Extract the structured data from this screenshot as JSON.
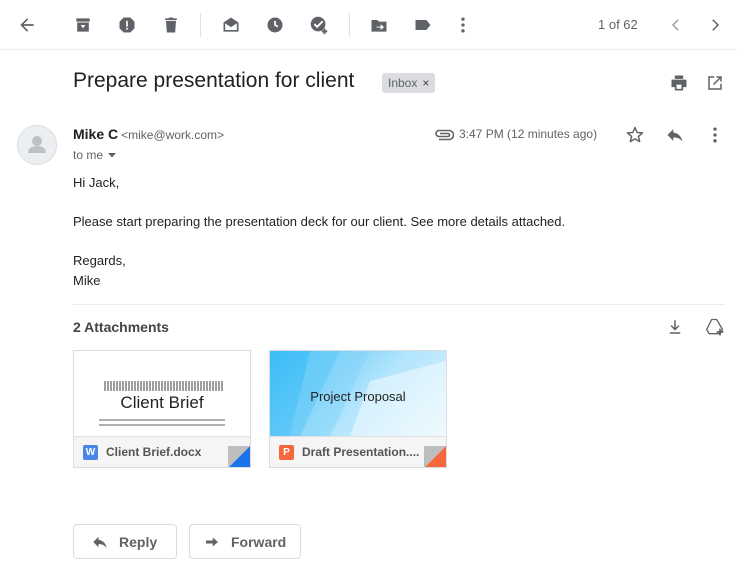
{
  "toolbar": {
    "icons": [
      "back-arrow-icon",
      "archive-icon",
      "report-spam-icon",
      "delete-icon",
      "mark-unread-icon",
      "snooze-icon",
      "add-to-tasks-icon",
      "move-to-icon",
      "labels-icon",
      "more-vert-icon"
    ],
    "pager": "1 of 62"
  },
  "email": {
    "subject": "Prepare presentation for client",
    "label": "Inbox",
    "label_remove": "×",
    "sender_name": "Mike C",
    "sender_email": "<mike@work.com>",
    "to_text": "to me",
    "time": "3:47 PM (12 minutes ago)",
    "body": {
      "greeting": "Hi Jack,",
      "paragraph": "Please start preparing the presentation deck for our client. See more details attached.",
      "signoff": "Regards,",
      "signature": "Mike"
    }
  },
  "attachments": {
    "title": "2 Attachments",
    "items": [
      {
        "thumb_title": "Client Brief",
        "filename": "Client Brief.docx",
        "badge": "W",
        "badge_color": "#4a86e8",
        "corner_color": "#1a73e8"
      },
      {
        "thumb_title": "Project Proposal",
        "filename": "Draft Presentation....",
        "badge": "P",
        "badge_color": "#f4683c",
        "corner_color": "#f4683c"
      }
    ]
  },
  "actions": {
    "reply": "Reply",
    "forward": "Forward"
  }
}
